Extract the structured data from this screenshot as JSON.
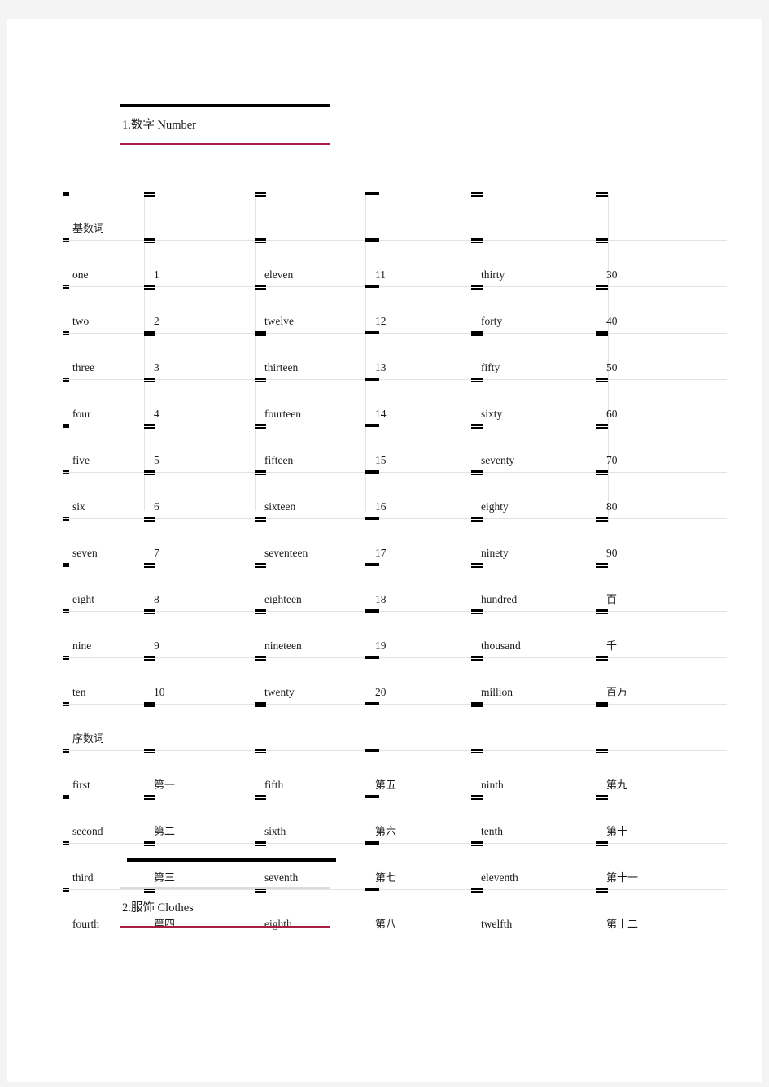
{
  "sections": [
    {
      "id": "s1",
      "title": "1.数字 Number"
    },
    {
      "id": "s2",
      "title": "2.服饰 Clothes"
    }
  ],
  "table": {
    "group_labels": {
      "cardinal": "基数词",
      "ordinal": "序数词"
    },
    "cardinal_rows": [
      {
        "w1": "one",
        "v1": "1",
        "w2": "eleven",
        "v2": "11",
        "w3": "thirty",
        "v3": "30"
      },
      {
        "w1": "two",
        "v1": "2",
        "w2": "twelve",
        "v2": "12",
        "w3": "forty",
        "v3": "40"
      },
      {
        "w1": "three",
        "v1": "3",
        "w2": "thirteen",
        "v2": "13",
        "w3": "fifty",
        "v3": "50"
      },
      {
        "w1": "four",
        "v1": "4",
        "w2": "fourteen",
        "v2": "14",
        "w3": "sixty",
        "v3": "60"
      },
      {
        "w1": "five",
        "v1": "5",
        "w2": "fifteen",
        "v2": "15",
        "w3": "seventy",
        "v3": "70"
      },
      {
        "w1": "six",
        "v1": "6",
        "w2": "sixteen",
        "v2": "16",
        "w3": "eighty",
        "v3": "80"
      },
      {
        "w1": "seven",
        "v1": "7",
        "w2": "seventeen",
        "v2": "17",
        "w3": "ninety",
        "v3": "90"
      },
      {
        "w1": "eight",
        "v1": "8",
        "w2": "eighteen",
        "v2": "18",
        "w3": "hundred",
        "v3": "百"
      },
      {
        "w1": "nine",
        "v1": "9",
        "w2": "nineteen",
        "v2": "19",
        "w3": "thousand",
        "v3": "千"
      },
      {
        "w1": "ten",
        "v1": "10",
        "w2": "twenty",
        "v2": "20",
        "w3": "million",
        "v3": "百万"
      }
    ],
    "ordinal_rows": [
      {
        "w1": "first",
        "v1": "第一",
        "w2": "fifth",
        "v2": "第五",
        "w3": "ninth",
        "v3": "第九"
      },
      {
        "w1": "second",
        "v1": "第二",
        "w2": "sixth",
        "v2": "第六",
        "w3": "tenth",
        "v3": "第十"
      },
      {
        "w1": "third",
        "v1": "第三",
        "w2": "seventh",
        "v2": "第七",
        "w3": "eleventh",
        "v3": "第十一"
      },
      {
        "w1": "fourth",
        "v1": "第四",
        "w2": "eighth",
        "v2": "第八",
        "w3": "twelfth",
        "v3": "第十二"
      }
    ]
  },
  "colors": {
    "accent_rule": "#a81e42",
    "heading_rule": "#000000",
    "grid_line": "#e3e3e3",
    "text": "#1b1b1b",
    "page_background": "#f4f4f4",
    "sheet_background": "#ffffff"
  }
}
